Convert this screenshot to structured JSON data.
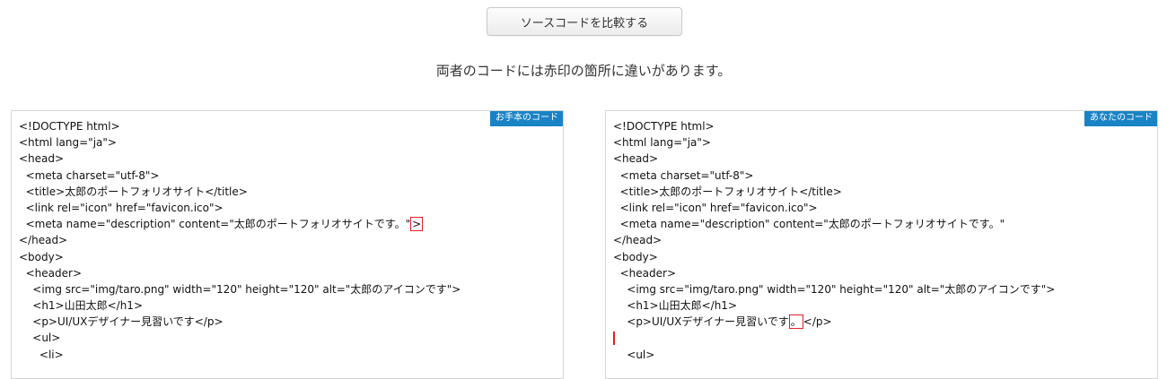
{
  "compare_button": {
    "label": "ソースコードを比較する"
  },
  "message": "両者のコードには赤印の箇所に違いがあります。",
  "panels": {
    "left": {
      "tag": "お手本のコード",
      "lines": [
        "<!DOCTYPE html>",
        "<html lang=\"ja\">",
        "<head>",
        "  <meta charset=\"utf-8\">",
        "  <title>太郎のポートフォリオサイト</title>",
        "  <link rel=\"icon\" href=\"favicon.ico\">",
        "  <meta name=\"description\" content=\"太郎のポートフォリオサイトです。\"",
        "</head>",
        "<body>",
        "  <header>",
        "    <img src=\"img/taro.png\" width=\"120\" height=\"120\" alt=\"太郎のアイコンです\">",
        "    <h1>山田太郎</h1>",
        "    <p>UI/UXデザイナー見習いです</p>",
        "    <ul>",
        "      <li>"
      ],
      "diff_char": ">"
    },
    "right": {
      "tag": "あなたのコード",
      "lines": [
        "<!DOCTYPE html>",
        "<html lang=\"ja\">",
        "<head>",
        "  <meta charset=\"utf-8\">",
        "  <title>太郎のポートフォリオサイト</title>",
        "  <link rel=\"icon\" href=\"favicon.ico\">",
        "  <meta name=\"description\" content=\"太郎のポートフォリオサイトです。\"",
        "</head>",
        "<body>",
        "  <header>",
        "    <img src=\"img/taro.png\" width=\"120\" height=\"120\" alt=\"太郎のアイコンです\">",
        "    <h1>山田太郎</h1>",
        "    <p>UI/UXデザイナー見習いです",
        "</p>",
        "",
        "    <ul>"
      ],
      "diff_char": "。"
    }
  },
  "colors": {
    "tag_background": "#1a83c6",
    "diff_marker": "#e02020"
  }
}
